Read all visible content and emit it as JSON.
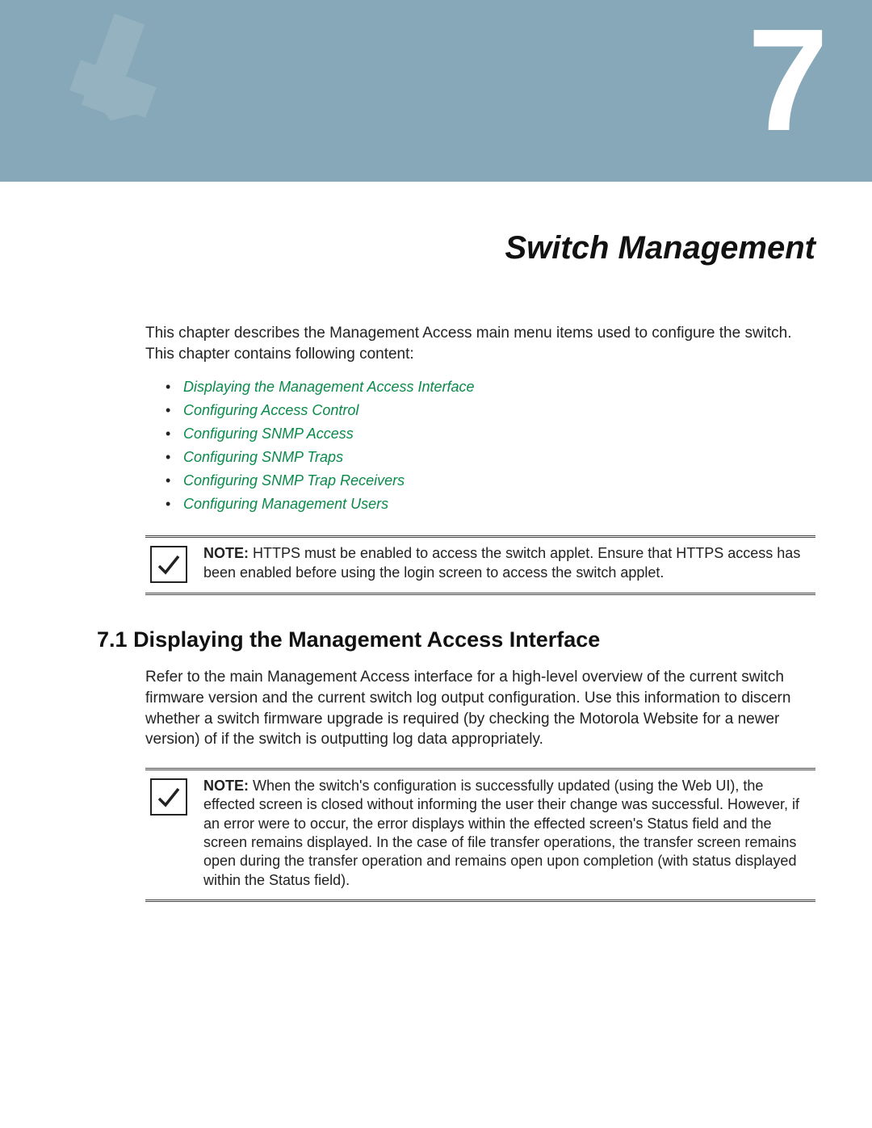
{
  "chapter": {
    "number": "7",
    "title": "Switch Management"
  },
  "intro": "This chapter describes the Management Access main menu items used to configure the switch. This chapter contains following content:",
  "toc": [
    "Displaying the Management Access Interface",
    "Configuring Access Control",
    "Configuring SNMP Access",
    "Configuring SNMP Traps",
    "Configuring SNMP Trap Receivers",
    "Configuring Management Users"
  ],
  "note1": {
    "label": "NOTE:",
    "text": " HTTPS must be enabled to access the switch applet. Ensure that HTTPS access has been enabled before using the login screen to access the switch applet."
  },
  "section": {
    "number": "7.1",
    "title": "Displaying the Management Access Interface"
  },
  "section_body": "Refer to the main Management Access interface for a high-level overview of the current switch firmware version and the current switch log output configuration. Use this information to discern whether a switch firmware upgrade is required (by checking the Motorola Website for a newer version) of if the switch is outputting log data appropriately.",
  "note2": {
    "label": "NOTE:",
    "text": " When the switch's configuration is successfully updated (using the Web UI), the effected screen is closed without informing the user their change was successful. However, if an error were to occur, the error displays within the effected screen's Status field and the screen remains displayed. In the case of file transfer operations, the transfer screen remains open during the transfer operation and remains open upon completion (with status displayed within the Status field)."
  }
}
